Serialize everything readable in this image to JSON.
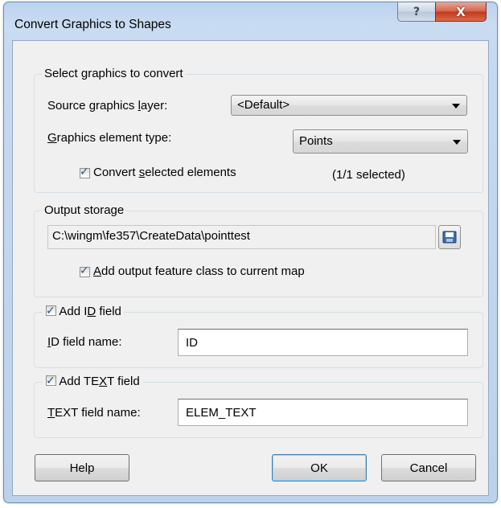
{
  "window": {
    "title": "Convert Graphics to Shapes",
    "help_glyph": "?",
    "close_glyph": "X"
  },
  "select_group": {
    "legend": "Select graphics to convert",
    "source_layer_label": [
      "Source graphics ",
      "l",
      "ayer:"
    ],
    "source_layer_value": "<Default>",
    "element_type_label": [
      "",
      "G",
      "raphics element type:"
    ],
    "element_type_value": "Points",
    "convert_selected_label": [
      "Convert ",
      "s",
      "elected elements"
    ],
    "convert_selected_checked": true,
    "selected_count": "(1/1 selected)"
  },
  "output_group": {
    "legend": "Output storage",
    "path": "C:\\wingm\\fe357\\CreateData\\pointtest",
    "add_to_map_label": [
      "",
      "A",
      "dd output feature class to current map"
    ],
    "add_to_map_checked": true
  },
  "id_group": {
    "checkbox_label": [
      "Add I",
      "D",
      " field"
    ],
    "checked": true,
    "field_label": [
      "",
      "I",
      "D field name:"
    ],
    "field_value": "ID"
  },
  "text_group": {
    "checkbox_label": [
      "Add TE",
      "X",
      "T field"
    ],
    "checked": true,
    "field_label": [
      "",
      "T",
      "EXT field name:"
    ],
    "field_value": "ELEM_TEXT"
  },
  "buttons": {
    "help": "Help",
    "ok": "OK",
    "cancel": "Cancel"
  },
  "icons": {
    "help": "question-mark-icon",
    "close": "close-x-icon",
    "checkbox": "checkmark-icon",
    "browse": "save-folder-icon"
  }
}
